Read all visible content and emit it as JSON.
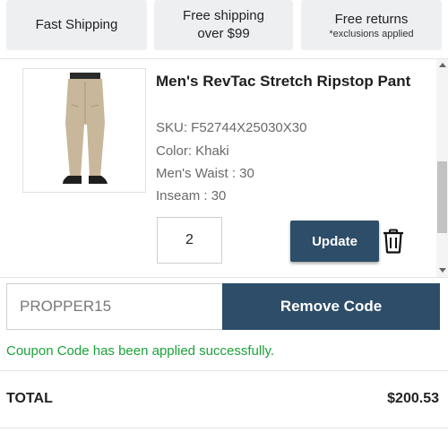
{
  "banners": {
    "fast_shipping": "Fast Shipping",
    "free_shipping_line1": "Free shipping",
    "free_shipping_line2": "over $99",
    "free_returns": "Free returns",
    "free_returns_note": "*exclusions applied"
  },
  "cart_item": {
    "title": "Men's RevTac Stretch Ripstop Pant",
    "sku": "SKU: F52744X25030X30",
    "color": "Color:  Khaki",
    "waist": "Men's Waist :  30",
    "inseam": "Inseam :  30",
    "quantity": "2",
    "update_label": "Update",
    "image_icon": "khaki-pants-image",
    "delete_icon": "trash-icon"
  },
  "coupon": {
    "code": "PROPPER15",
    "remove_label": "Remove Code",
    "success_message": "Coupon Code has been applied successfully."
  },
  "summary": {
    "total_label": "TOTAL",
    "total_value": "$200.53"
  },
  "colors": {
    "accent": "#2d4d68",
    "success": "#1aa33a",
    "banner_bg": "#eeeff1"
  }
}
